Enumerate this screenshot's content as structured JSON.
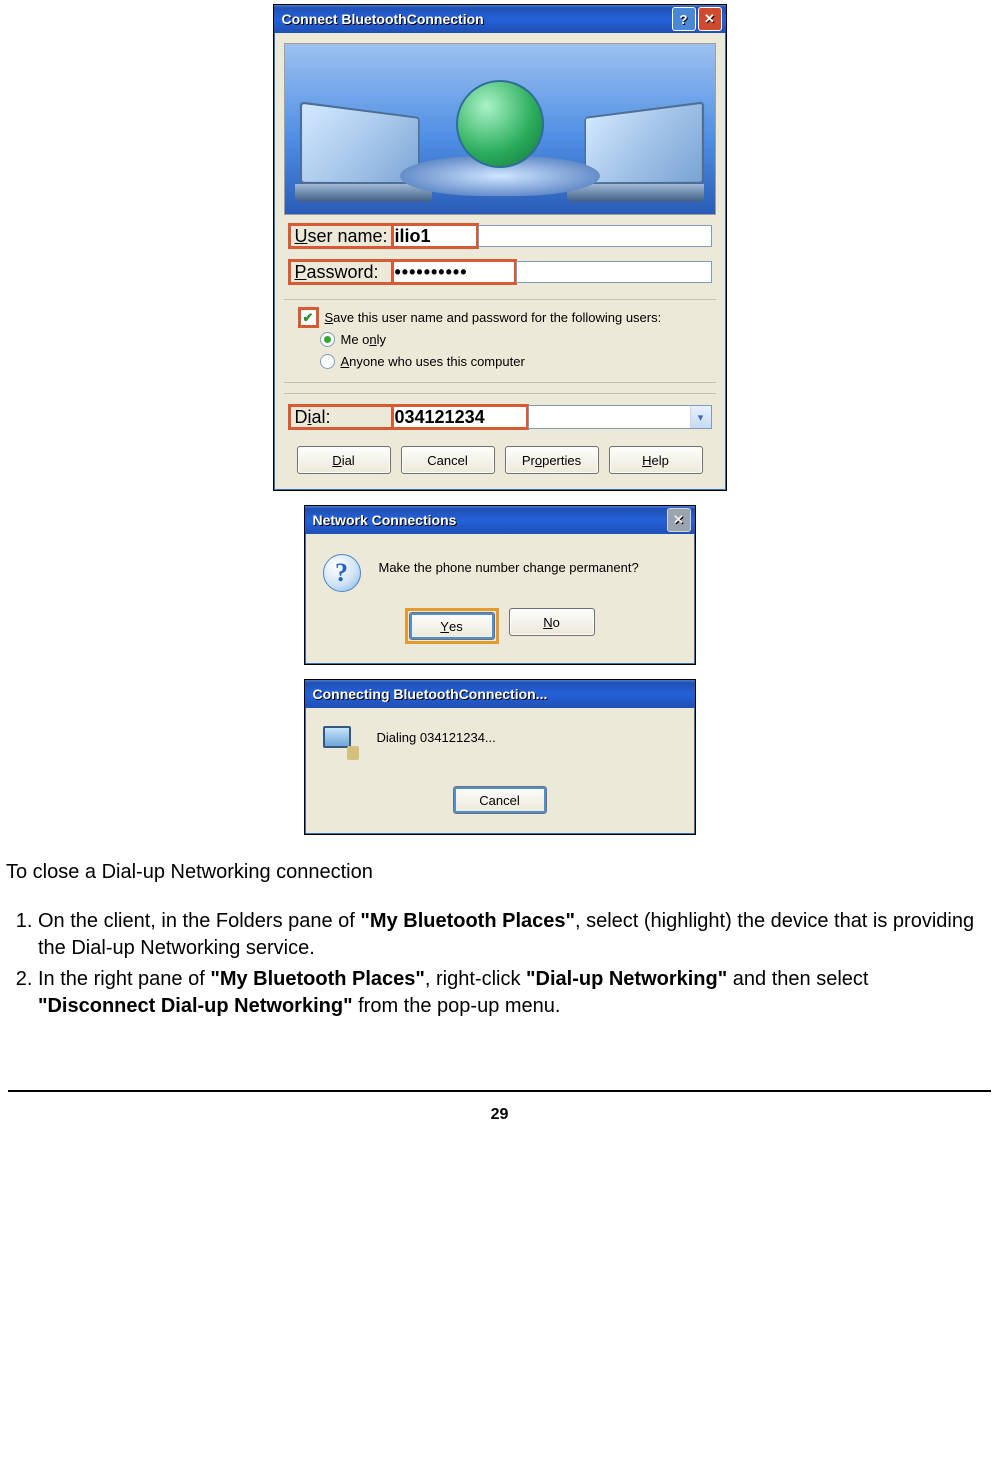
{
  "connect_dialog": {
    "title": "Connect BluetoothConnection",
    "username_label": "User name:",
    "username_value": "ilio1",
    "password_label": "Password:",
    "password_value": "••••••••••",
    "save_checkbox_label": "Save this user name and password for the following users:",
    "save_checked": true,
    "opt_me_only": "Me only",
    "opt_anyone": "Anyone who uses this computer",
    "opt_selected": "me",
    "dial_label": "Dial:",
    "dial_value": "034121234",
    "buttons": {
      "dial": "Dial",
      "cancel": "Cancel",
      "properties": "Properties",
      "help": "Help"
    }
  },
  "msgbox": {
    "title": "Network Connections",
    "message": "Make the phone number change permanent?",
    "yes": "Yes",
    "no": "No"
  },
  "connecting_dialog": {
    "title": "Connecting BluetoothConnection...",
    "status": "Dialing 034121234...",
    "cancel": "Cancel"
  },
  "instructions": {
    "heading": "To close a Dial-up Networking connection",
    "step1_a": "On the client, in the Folders pane of ",
    "step1_b": "\"My Bluetooth Places\"",
    "step1_c": ", select (highlight) the device that is providing the Dial-up Networking service.",
    "step2_a": "In the right pane of ",
    "step2_b": "\"My Bluetooth Places\"",
    "step2_c": ", right-click ",
    "step2_d": "\"Dial-up Networking\"",
    "step2_e": " and then select ",
    "step2_f": "\"Disconnect Dial-up Networking\"",
    "step2_g": " from the pop-up menu."
  },
  "page_number": "29"
}
